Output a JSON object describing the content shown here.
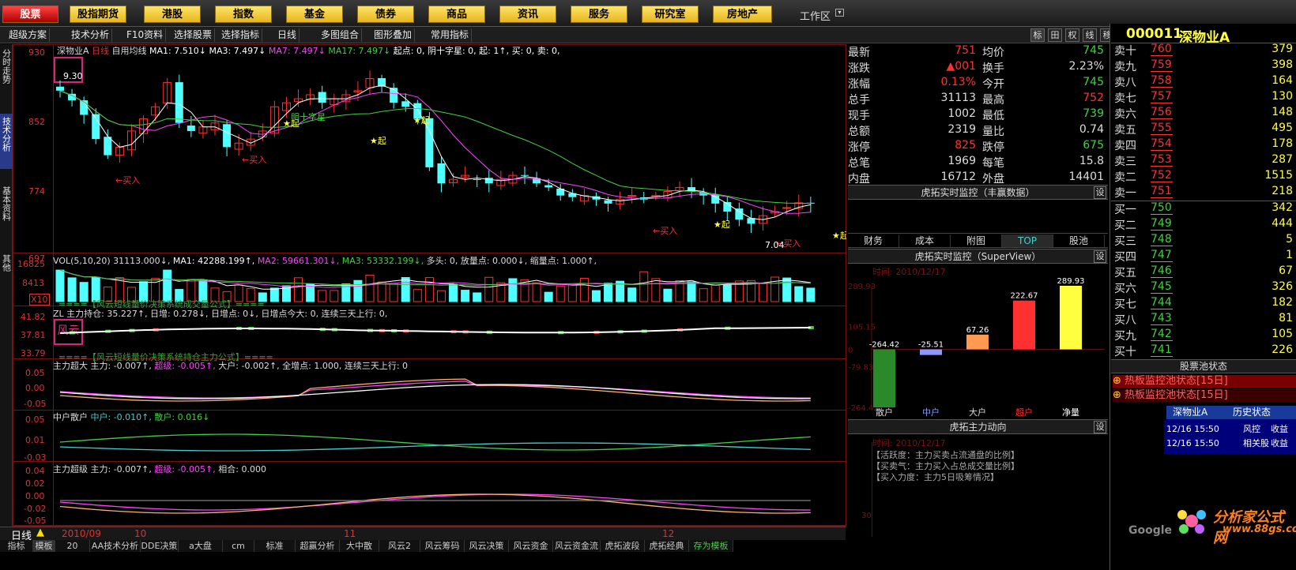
{
  "topmenu": {
    "items": [
      "股票",
      "股指期货",
      "港股",
      "指数",
      "基金",
      "债券",
      "商品",
      "资讯",
      "服务",
      "研究室",
      "房地产"
    ],
    "workspace": "工作区"
  },
  "toolbar": {
    "items": [
      "超级方案",
      "技术分析",
      "F10资料",
      "选择股票",
      "选择指标",
      "日线",
      "多图组合",
      "图形叠加",
      "常用指标"
    ],
    "right_icons": [
      "标",
      "田",
      "权",
      "线",
      "移"
    ]
  },
  "left_tabs": [
    "分时走势",
    "技术分析",
    "基本资料",
    "其他"
  ],
  "chart": {
    "stock": "深物业A",
    "period": "日线",
    "ma_header": {
      "label": "自用均线",
      "ma1": "MA1: 7.510↓",
      "ma3": "MA3: 7.497↓",
      "ma7": "MA7: 7.497↓",
      "ma17": "MA17: 7.497↓",
      "tail": "起点: 0, 阴十字星: 0, 起: 1↑, 买: 0, 卖: 0,"
    },
    "price_labels": [
      "930",
      "852",
      "774",
      "697"
    ],
    "annotations": {
      "buy": "买入",
      "start": "起",
      "ma_label": "明十字星",
      "low": "7.04",
      "top_label": "9.30"
    },
    "vol_header": {
      "main": "VOL(5,10,20) 31113.000↓,",
      "ma1": "MA1: 42288.199↑,",
      "ma2": "MA2: 59661.301↓,",
      "ma3": "MA3: 53332.199↓,",
      "tail": "多头: 0, 放量点: 0.000↓, 缩量点: 1.000↑,"
    },
    "vol_labels": [
      "16825",
      "8413",
      "X10"
    ],
    "zl_header": "ZL 主力持仓: 35.227↑, 日增: 0.278↓, 日增点: 0↓, 日增点今大: 0, 连续三天上行: 0,",
    "zl_labels": [
      "41.82",
      "37.81",
      "33.79"
    ],
    "zl_logo": "风云",
    "zl_formula": "====【风云短线量价决策系统持仓主力公式】====",
    "vol_formula": "====【风云短线量价决策系统成交量公式】====",
    "ind3_header": {
      "name": "主力超大",
      "v1": "主力: -0.007↑,",
      "v2": "超级: -0.005↑,",
      "v3": "大户: -0.002↑,",
      "tail": "全增点: 1.000, 连续三天上行: 0"
    },
    "ind3_labels": [
      "0.05",
      "0.00",
      "-0.05"
    ],
    "ind4_header": {
      "name": "中户散户",
      "v1": "中户: -0.010↑,",
      "v2": "散户: 0.016↓"
    },
    "ind4_labels": [
      "0.05",
      "0.01",
      "-0.03"
    ],
    "ind5_header": {
      "name": "主力超级",
      "v1": "主力: -0.007↑,",
      "v2": "超级: -0.005↑,",
      "v3": "相合: 0.000"
    },
    "ind5_labels": [
      "0.04",
      "0.02",
      "0.00",
      "-0.02",
      "-0.05"
    ],
    "date_bar": {
      "period": "日线",
      "d1": "2010/09",
      "d2": "10",
      "d3": "11",
      "d4": "12"
    }
  },
  "bottom_tabs": [
    "指标",
    "模板",
    "20",
    "AA技术分析",
    "DDE决策",
    "a大盘",
    "cm",
    "标准",
    "超赢分析",
    "大中散",
    "风云2",
    "风云筹码",
    "风云决策",
    "风云资金",
    "风云资金流",
    "虎拓波段",
    "虎拓经典",
    "存为模板"
  ],
  "quote": {
    "rows": [
      {
        "l1": "最新",
        "v1": "751",
        "l2": "均价",
        "v2": "745"
      },
      {
        "l1": "涨跌",
        "v1": "▲001",
        "l2": "换手",
        "v2": "2.23%"
      },
      {
        "l1": "涨幅",
        "v1": "0.13%",
        "l2": "今开",
        "v2": "745"
      },
      {
        "l1": "总手",
        "v1": "31113",
        "l2": "最高",
        "v2": "752"
      },
      {
        "l1": "现手",
        "v1": "1002",
        "l2": "最低",
        "v2": "739"
      },
      {
        "l1": "总额",
        "v1": "2319",
        "l2": "量比",
        "v2": "0.74"
      },
      {
        "l1": "涨停",
        "v1": "825",
        "l2": "跌停",
        "v2": "675"
      },
      {
        "l1": "总笔",
        "v1": "1969",
        "l2": "每笔",
        "v2": "15.8"
      },
      {
        "l1": "内盘",
        "v1": "16712",
        "l2": "外盘",
        "v2": "14401"
      }
    ]
  },
  "monitor1": {
    "title": "虎拓实时监控（丰赢数据）",
    "setting": "设",
    "tabs": [
      "财务",
      "成本",
      "附图",
      "TOP",
      "股池"
    ]
  },
  "monitor2": {
    "title": "虎拓实时监控（SuperView）",
    "setting": "设",
    "date": "时间: 2010/12/17",
    "axis": [
      "289.93",
      "105.15",
      "0",
      "-79.83",
      "-264.42"
    ],
    "bars": [
      {
        "name": "散户",
        "value": -264.42,
        "label": "-264.42",
        "color": "#2a8a2a"
      },
      {
        "name": "中户",
        "value": -25.51,
        "label": "-25.51",
        "color": "#8a9aff"
      },
      {
        "name": "大户",
        "value": 67.26,
        "label": "67.26",
        "color": "#ff9a50"
      },
      {
        "name": "超户",
        "value": 222.67,
        "label": "222.67",
        "color": "#ff3030"
      },
      {
        "name": "净量",
        "value": 289.93,
        "label": "289.93",
        "color": "#ffff40"
      }
    ]
  },
  "monitor3": {
    "title": "虎拓主力动向",
    "setting": "设",
    "date": "时间: 2010/12/17",
    "notes": [
      "【活跃度：主力买卖占流通盘的比例】",
      "【买卖气：主力买入占总成交量比例】",
      "【买入力度：主力5日吸筹情况】"
    ],
    "axis_top": "30"
  },
  "orderbook": {
    "code": "000011",
    "name": "深物业A",
    "asks": [
      {
        "label": "卖十",
        "price": "760",
        "vol": "379"
      },
      {
        "label": "卖九",
        "price": "759",
        "vol": "398"
      },
      {
        "label": "卖八",
        "price": "758",
        "vol": "164"
      },
      {
        "label": "卖七",
        "price": "757",
        "vol": "130"
      },
      {
        "label": "卖六",
        "price": "756",
        "vol": "148"
      },
      {
        "label": "卖五",
        "price": "755",
        "vol": "495"
      },
      {
        "label": "卖四",
        "price": "754",
        "vol": "178"
      },
      {
        "label": "卖三",
        "price": "753",
        "vol": "287"
      },
      {
        "label": "卖二",
        "price": "752",
        "vol": "1515"
      },
      {
        "label": "卖一",
        "price": "751",
        "vol": "218"
      }
    ],
    "bids": [
      {
        "label": "买一",
        "price": "750",
        "vol": "342"
      },
      {
        "label": "买二",
        "price": "749",
        "vol": "444"
      },
      {
        "label": "买三",
        "price": "748",
        "vol": "5"
      },
      {
        "label": "买四",
        "price": "747",
        "vol": "1"
      },
      {
        "label": "买五",
        "price": "746",
        "vol": "67"
      },
      {
        "label": "买六",
        "price": "745",
        "vol": "326"
      },
      {
        "label": "买七",
        "price": "744",
        "vol": "182"
      },
      {
        "label": "买八",
        "price": "743",
        "vol": "81"
      },
      {
        "label": "买九",
        "price": "742",
        "vol": "105"
      },
      {
        "label": "买十",
        "price": "741",
        "vol": "226"
      }
    ],
    "pool_title": "股票池状态",
    "pool_items": [
      "热板监控池状态[15日]",
      "热板监控池状态[15日]"
    ],
    "history_tabs": [
      "深物业A",
      "历史状态"
    ],
    "history": [
      {
        "date": "12/16 15:50",
        "type": "风控",
        "result": "收益"
      },
      {
        "date": "12/16 15:50",
        "type": "相关股",
        "result": "收益"
      }
    ]
  },
  "watermark": {
    "brand": "分析家公式网",
    "url": "www.88gs.com",
    "google": "Google"
  },
  "colors": {
    "up": "#ff3030",
    "down": "#50ffff",
    "ma1": "#ffffff",
    "ma2": "#ff40ff",
    "ma3": "#40d040",
    "bg": "#000000",
    "frame": "#8a1010"
  }
}
